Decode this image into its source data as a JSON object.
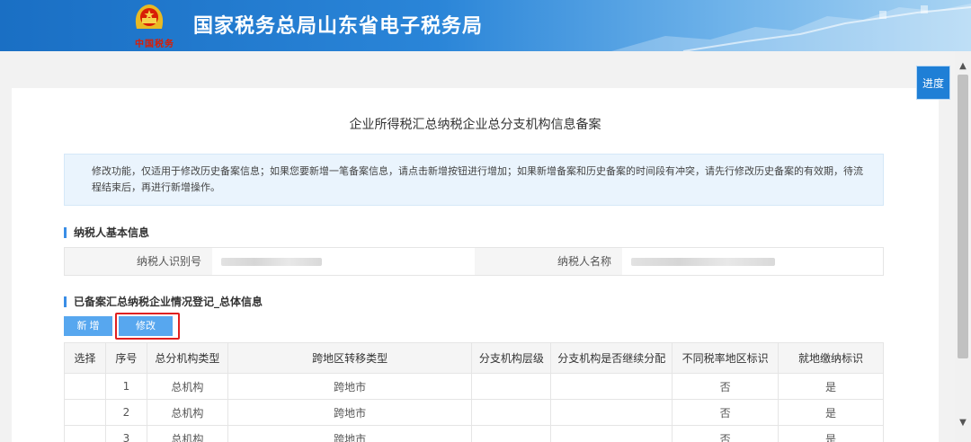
{
  "header": {
    "site_title": "国家税务总局山东省电子税务局",
    "emblem_script": "中国税务"
  },
  "page": {
    "title": "企业所得税汇总纳税企业总分支机构信息备案",
    "notice": "修改功能，仅适用于修改历史备案信息；如果您要新增一笔备案信息，请点击新增按钮进行增加；如果新增备案和历史备案的时间段有冲突，请先行修改历史备案的有效期，待流程结束后，再进行新增操作。"
  },
  "taxpayer": {
    "section_title": "纳税人基本信息",
    "id_label": "纳税人识别号",
    "name_label": "纳税人名称"
  },
  "filing": {
    "section_title": "已备案汇总纳税企业情况登记_总体信息",
    "add_label": "新 增",
    "edit_label": "修改",
    "columns": [
      "选择",
      "序号",
      "总分机构类型",
      "跨地区转移类型",
      "分支机构层级",
      "分支机构是否继续分配",
      "不同税率地区标识",
      "就地缴纳标识"
    ],
    "rows": [
      {
        "select": "",
        "seq": "1",
        "type": "总机构",
        "transfer": "跨地市",
        "level": "",
        "continue": "",
        "rate_flag": "否",
        "local_flag": "是"
      },
      {
        "select": "",
        "seq": "2",
        "type": "总机构",
        "transfer": "跨地市",
        "level": "",
        "continue": "",
        "rate_flag": "否",
        "local_flag": "是"
      },
      {
        "select": "",
        "seq": "3",
        "type": "总机构",
        "transfer": "跨地市",
        "level": "",
        "continue": "",
        "rate_flag": "否",
        "local_flag": "是"
      }
    ]
  },
  "side": {
    "progress_label": "进度"
  },
  "icons": {
    "emblem": "national-emblem-icon",
    "scroll_up": "chevron-up-icon",
    "scroll_down": "chevron-down-icon"
  },
  "colors": {
    "header_blue": "#1a6fc4",
    "accent": "#3a8ee6",
    "button": "#57a7ef",
    "highlight": "#e02020"
  }
}
